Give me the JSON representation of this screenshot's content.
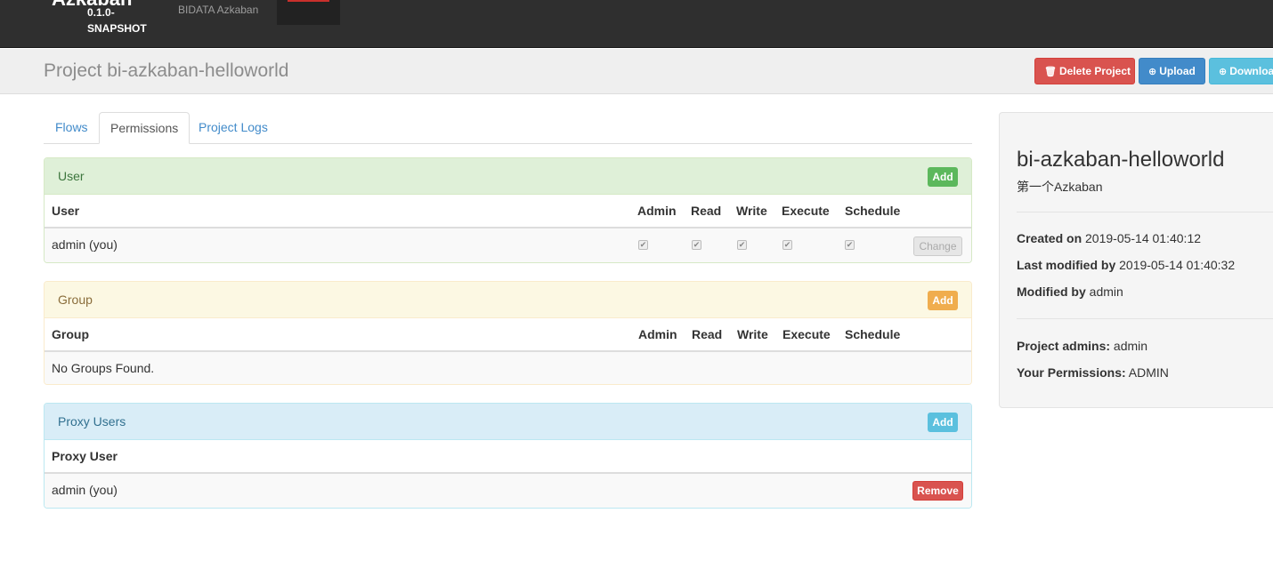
{
  "navbar": {
    "brand": "Azkaban",
    "version": "0.1.0-SNAPSHOT",
    "subtitle": "BIDATA Azkaban"
  },
  "header": {
    "title": "Project bi-azkaban-helloworld",
    "delete_label": "Delete Project",
    "upload_label": "Upload",
    "download_label": "Download"
  },
  "tabs": [
    "Flows",
    "Permissions",
    "Project Logs"
  ],
  "user_panel": {
    "title": "User",
    "add_label": "Add",
    "columns": [
      "User",
      "Admin",
      "Read",
      "Write",
      "Execute",
      "Schedule"
    ],
    "rows": [
      {
        "name": "admin (you)",
        "admin": true,
        "read": true,
        "write": true,
        "execute": true,
        "schedule": true,
        "action": "Change"
      }
    ]
  },
  "group_panel": {
    "title": "Group",
    "add_label": "Add",
    "columns": [
      "Group",
      "Admin",
      "Read",
      "Write",
      "Execute",
      "Schedule"
    ],
    "empty": "No Groups Found."
  },
  "proxy_panel": {
    "title": "Proxy Users",
    "add_label": "Add",
    "column": "Proxy User",
    "rows": [
      {
        "name": "admin (you)",
        "action": "Remove"
      }
    ]
  },
  "sidebar": {
    "project_name": "bi-azkaban-helloworld",
    "description": "第一个Azkaban",
    "created_label": "Created on",
    "created_value": "2019-05-14 01:40:12",
    "modified_label": "Last modified by",
    "modified_value": "2019-05-14 01:40:32",
    "modified_by_label": "Modified by",
    "modified_by_value": "admin",
    "admins_label": "Project admins:",
    "admins_value": "admin",
    "perms_label": "Your Permissions:",
    "perms_value": "ADMIN"
  }
}
